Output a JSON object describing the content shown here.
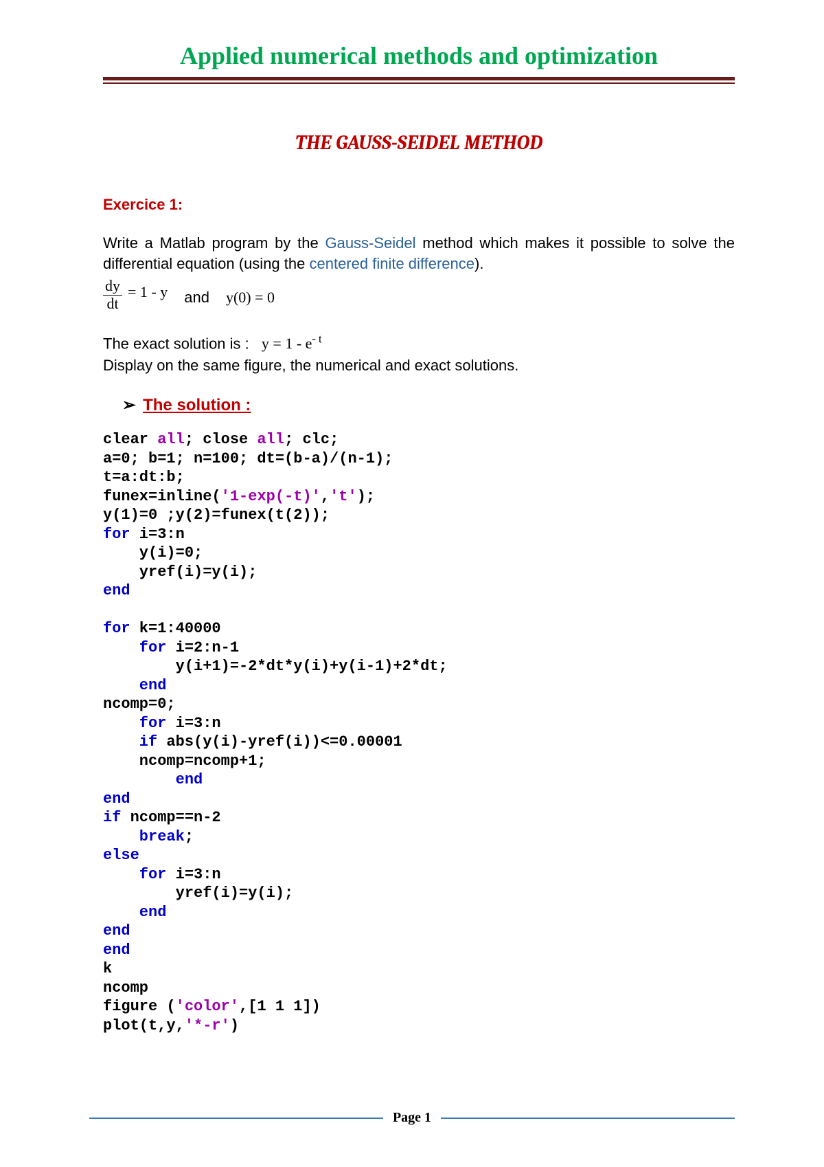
{
  "header": {
    "title": "Applied numerical methods and optimization"
  },
  "doc_title": "THE GAUSS-SEIDEL METHOD",
  "exercise_label": "Exercice 1:",
  "description": {
    "pre": "Write a Matlab program by the ",
    "method": "Gauss-Seidel",
    "mid": " method which makes it possible to solve the differential equation (using the ",
    "cfd": "centered finite difference",
    "post": ")."
  },
  "equation": {
    "frac_num": "dy",
    "frac_den": "dt",
    "eq_rhs": "= 1 - y",
    "and": "and",
    "initial": "y(0) = 0"
  },
  "exact": {
    "label": "The exact solution is :",
    "eq_lhs": "y = 1 - e",
    "eq_sup": "- t"
  },
  "display_line": "Display on the same figure, the numerical and exact solutions.",
  "solution_heading": "The solution :",
  "code": {
    "l01a": "clear ",
    "l01b": "all",
    "l01c": "; close ",
    "l01d": "all",
    "l01e": "; clc;",
    "l02": "a=0; b=1; n=100; dt=(b-a)/(n-1);",
    "l03": "t=a:dt:b;",
    "l04a": "funex=inline(",
    "l04b": "'1-exp(-t)'",
    "l04c": ",",
    "l04d": "'t'",
    "l04e": ");",
    "l05": "y(1)=0 ;y(2)=funex(t(2));",
    "l06a": "for",
    "l06b": " i=3:n",
    "l07": "    y(i)=0;",
    "l08": "    yref(i)=y(i);",
    "l09": "end",
    "blank1": "",
    "l10a": "for",
    "l10b": " k=1:40000",
    "l11a": "    for",
    "l11b": " i=2:n-1",
    "l12": "        y(i+1)=-2*dt*y(i)+y(i-1)+2*dt;",
    "l13": "    end",
    "l14": "ncomp=0;",
    "l15a": "    for",
    "l15b": " i=3:n",
    "l16a": "    if",
    "l16b": " abs(y(i)-yref(i))<=0.00001",
    "l17": "    ncomp=ncomp+1;",
    "l18": "        end",
    "l19": "end",
    "l20a": "if",
    "l20b": " ncomp==n-2",
    "l21a": "    break",
    "l21b": ";",
    "l22": "else",
    "l23a": "    for",
    "l23b": " i=3:n",
    "l24": "        yref(i)=y(i);",
    "l25": "    end",
    "l26": "end",
    "l27": "end",
    "l28": "k",
    "l29": "ncomp",
    "l30a": "figure (",
    "l30b": "'color'",
    "l30c": ",[1 1 1])",
    "l31a": "plot(t,y,",
    "l31b": "'*-r'",
    "l31c": ")"
  },
  "footer": {
    "page_label": "Page 1"
  }
}
